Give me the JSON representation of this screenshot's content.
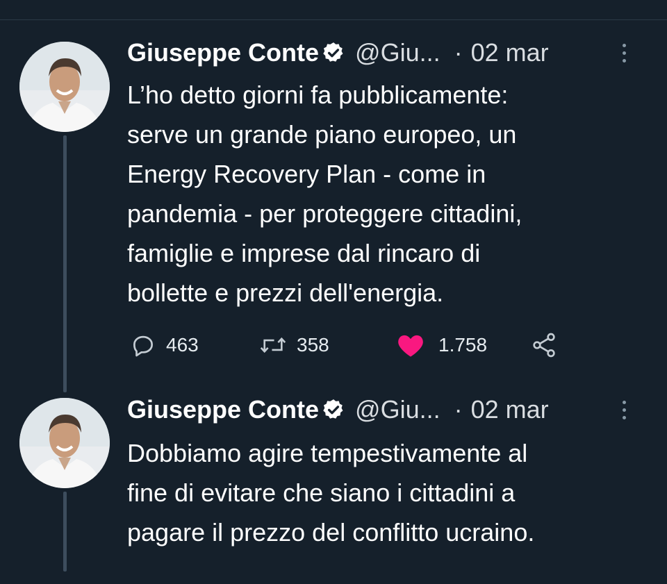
{
  "tweets": [
    {
      "author_name": "Giuseppe Conte",
      "handle": "@Giu...",
      "separator": "·",
      "date": "02 mar",
      "text": "L’ho detto giorni fa pubblicamente:\nserve un grande piano europeo, un\nEnergy Recovery Plan - come in\npandemia - per proteggere cittadini,\nfamiglie e imprese dal rincaro di\nbollette e prezzi dell'energia.",
      "replies": "463",
      "retweets": "358",
      "likes": "1.758",
      "liked": true
    },
    {
      "author_name": "Giuseppe Conte",
      "handle": "@Giu...",
      "separator": "·",
      "date": "02 mar",
      "text": "Dobbiamo agire tempestivamente al\nfine di evitare che siano i cittadini a\npagare il prezzo del conflitto ucraino."
    }
  ],
  "icons": {
    "verified": "verified-badge-icon",
    "more": "more-options-icon",
    "reply": "reply-icon",
    "retweet": "retweet-icon",
    "like": "heart-icon",
    "share": "share-icon"
  },
  "colors": {
    "background": "#15202b",
    "like_pink": "#f91880",
    "secondary_text": "#d9dde1",
    "thread_line": "#3d4d5d"
  }
}
